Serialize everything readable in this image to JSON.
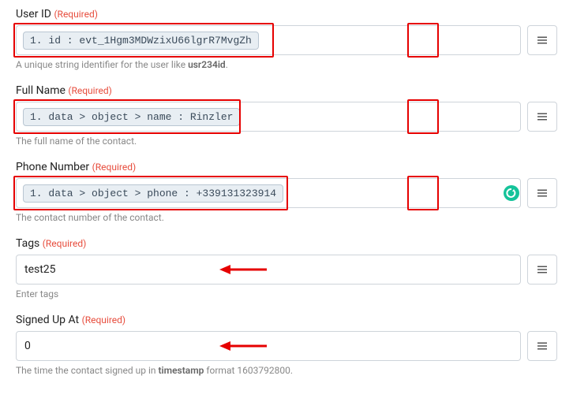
{
  "fields": {
    "userId": {
      "label": "User ID",
      "required": "(Required)",
      "pill": "1. id : evt_1Hgm3MDWzixU66lgrR7MvgZh",
      "helper_pre": "A unique string identifier for the user like ",
      "helper_strong": "usr234id",
      "helper_post": "."
    },
    "fullName": {
      "label": "Full Name",
      "required": "(Required)",
      "pill": "1. data > object > name : Rinzler",
      "helper": "The full name of the contact."
    },
    "phone": {
      "label": "Phone Number",
      "required": "(Required)",
      "pill": "1. data > object > phone : +339131323914",
      "helper": "The contact number of the contact."
    },
    "tags": {
      "label": "Tags",
      "required": "(Required)",
      "value": "test25",
      "helper": "Enter tags"
    },
    "signedUp": {
      "label": "Signed Up At",
      "required": "(Required)",
      "value": "0",
      "helper_pre": "The time the contact signed up in ",
      "helper_strong": "timestamp",
      "helper_post": " format 1603792800."
    }
  }
}
